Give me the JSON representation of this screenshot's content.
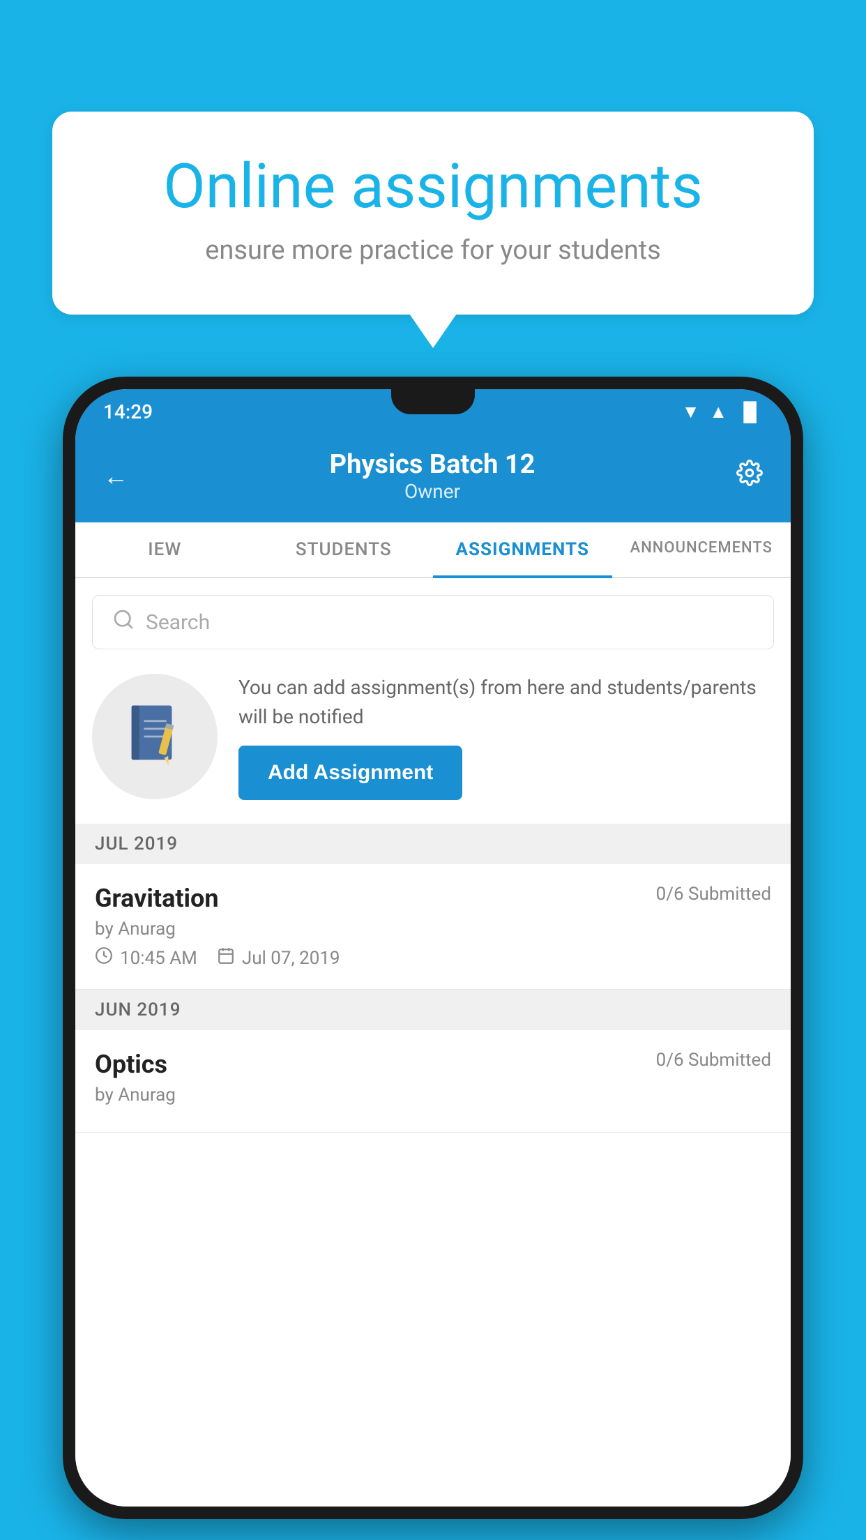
{
  "background_color": "#1ab3e8",
  "bubble": {
    "title": "Online assignments",
    "subtitle": "ensure more practice for your students"
  },
  "status_bar": {
    "time": "14:29",
    "wifi": "▼",
    "signal": "▲",
    "battery": "▐"
  },
  "header": {
    "title": "Physics Batch 12",
    "subtitle": "Owner"
  },
  "tabs": [
    {
      "label": "IEW",
      "active": false
    },
    {
      "label": "STUDENTS",
      "active": false
    },
    {
      "label": "ASSIGNMENTS",
      "active": true
    },
    {
      "label": "ANNOUNCEMENTS",
      "active": false
    }
  ],
  "search": {
    "placeholder": "Search"
  },
  "promo": {
    "description": "You can add assignment(s) from here and students/parents will be notified",
    "button_label": "Add Assignment"
  },
  "sections": [
    {
      "month": "JUL 2019",
      "assignments": [
        {
          "name": "Gravitation",
          "submitted": "0/6 Submitted",
          "by": "by Anurag",
          "time": "10:45 AM",
          "date": "Jul 07, 2019"
        }
      ]
    },
    {
      "month": "JUN 2019",
      "assignments": [
        {
          "name": "Optics",
          "submitted": "0/6 Submitted",
          "by": "by Anurag",
          "time": "",
          "date": ""
        }
      ]
    }
  ]
}
